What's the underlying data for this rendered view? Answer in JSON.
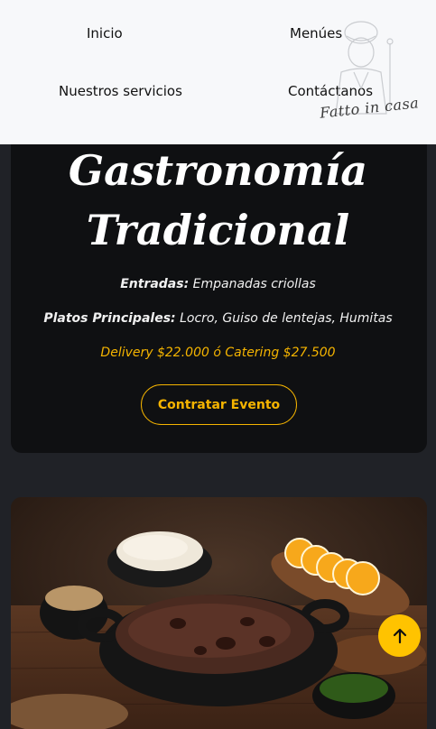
{
  "nav": {
    "inicio": "Inicio",
    "menues": "Menúes",
    "servicios": "Nuestros servicios",
    "contacto": "Contáctanos"
  },
  "logo": {
    "text": "Fatto in casa",
    "icon": "chef-logo-icon"
  },
  "menu": {
    "title_line1": "Gastronomía",
    "title_line2": "Tradicional",
    "entradas_label": "Entradas:",
    "entradas_value": "Empanadas criollas",
    "platos_label": "Platos Principales:",
    "platos_value": "Locro, Guiso de lentejas, Humitas",
    "price": "Delivery $22.000 ó Catering $27.500",
    "cta": "Contratar Evento"
  },
  "scroll_top": {
    "icon": "arrow-up-icon"
  },
  "colors": {
    "accent": "#f5b400",
    "background": "#202227",
    "card": "#0f1012",
    "navbar": "#f7f8fa"
  }
}
